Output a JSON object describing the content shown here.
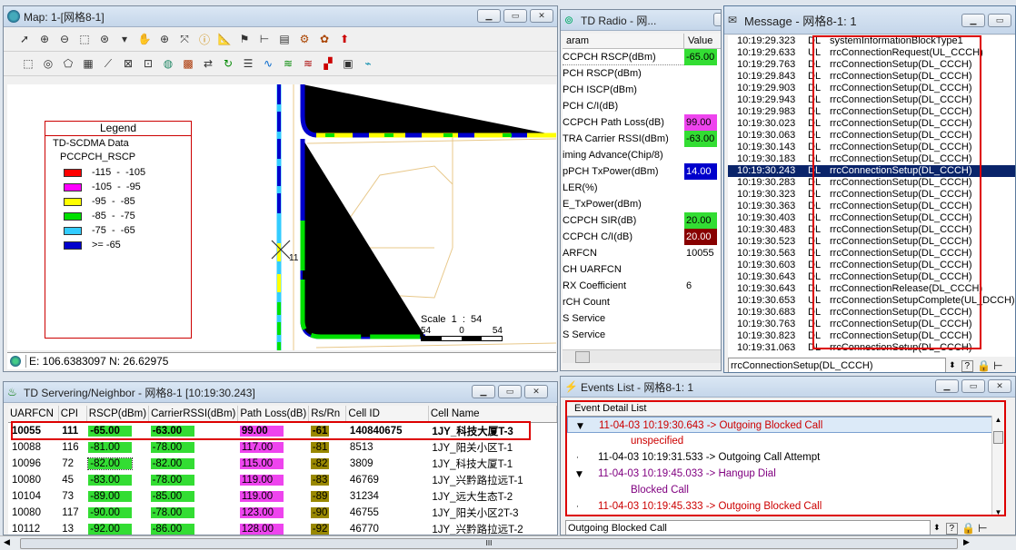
{
  "map": {
    "title": "Map: 1-[网格8-1]",
    "legend": {
      "header": "Legend",
      "data_title": "TD-SCDMA Data",
      "subtitle": "PCCPCH_RSCP",
      "items": [
        {
          "label": "-115  -  -105",
          "color": "#ff0000"
        },
        {
          "label": "-105  -  -95",
          "color": "#ff00ff"
        },
        {
          "label": "-95  -  -85",
          "color": "#ffff00"
        },
        {
          "label": "-85  -  -75",
          "color": "#00e000"
        },
        {
          "label": "-75  -  -65",
          "color": "#33ccff"
        },
        {
          "label": ">= -65",
          "color": "#0000cc"
        }
      ]
    },
    "scale": {
      "label": "Scale  1  :  54",
      "ticks": [
        "54",
        "0",
        "54"
      ]
    },
    "marker_label": "11",
    "status": "E: 106.6383097 N: 26.62975"
  },
  "td_radio": {
    "title": "TD Radio - 网...",
    "header": {
      "param": "aram",
      "value": "Value"
    },
    "rows": [
      {
        "param": "CCPCH RSCP(dBm)",
        "value": "-65.00",
        "color": "#33dd33"
      },
      {
        "param": "PCH RSCP(dBm)",
        "value": "",
        "color": ""
      },
      {
        "param": "PCH ISCP(dBm)",
        "value": "",
        "color": ""
      },
      {
        "param": "PCH C/I(dB)",
        "value": "",
        "color": ""
      },
      {
        "param": "CCPCH Path Loss(dB)",
        "value": "99.00",
        "color": "#ee44ee"
      },
      {
        "param": "TRA Carrier RSSI(dBm)",
        "value": "-63.00",
        "color": "#33dd33"
      },
      {
        "param": "iming Advance(Chip/8)",
        "value": "",
        "color": ""
      },
      {
        "param": "pPCH TxPower(dBm)",
        "value": "14.00",
        "color": "#0000cc"
      },
      {
        "param": "LER(%)",
        "value": "",
        "color": ""
      },
      {
        "param": "E_TxPower(dBm)",
        "value": "",
        "color": ""
      },
      {
        "param": "CCPCH SIR(dB)",
        "value": "20.00",
        "color": "#33dd33"
      },
      {
        "param": "CCPCH C/I(dB)",
        "value": "20.00",
        "color": "#880000"
      },
      {
        "param": "ARFCN",
        "value": "10055",
        "color": ""
      },
      {
        "param": "CH UARFCN",
        "value": "",
        "color": ""
      },
      {
        "param": "RX Coefficient",
        "value": "6",
        "color": ""
      },
      {
        "param": "rCH Count",
        "value": "",
        "color": ""
      },
      {
        "param": "S Service",
        "value": "",
        "color": ""
      },
      {
        "param": "S Service",
        "value": "",
        "color": ""
      }
    ]
  },
  "message": {
    "title": "Message - 网格8-1: 1",
    "rows": [
      {
        "time": "10:19:29.323",
        "dir": "DL",
        "msg": "systemInformationBlockType1"
      },
      {
        "time": "10:19:29.633",
        "dir": "UL",
        "msg": "rrcConnectionRequest(UL_CCCH)"
      },
      {
        "time": "10:19:29.763",
        "dir": "DL",
        "msg": "rrcConnectionSetup(DL_CCCH)"
      },
      {
        "time": "10:19:29.843",
        "dir": "DL",
        "msg": "rrcConnectionSetup(DL_CCCH)"
      },
      {
        "time": "10:19:29.903",
        "dir": "DL",
        "msg": "rrcConnectionSetup(DL_CCCH)"
      },
      {
        "time": "10:19:29.943",
        "dir": "DL",
        "msg": "rrcConnectionSetup(DL_CCCH)"
      },
      {
        "time": "10:19:29.983",
        "dir": "DL",
        "msg": "rrcConnectionSetup(DL_CCCH)"
      },
      {
        "time": "10:19:30.023",
        "dir": "DL",
        "msg": "rrcConnectionSetup(DL_CCCH)"
      },
      {
        "time": "10:19:30.063",
        "dir": "DL",
        "msg": "rrcConnectionSetup(DL_CCCH)"
      },
      {
        "time": "10:19:30.143",
        "dir": "DL",
        "msg": "rrcConnectionSetup(DL_CCCH)"
      },
      {
        "time": "10:19:30.183",
        "dir": "DL",
        "msg": "rrcConnectionSetup(DL_CCCH)"
      },
      {
        "time": "10:19:30.243",
        "dir": "DL",
        "msg": "rrcConnectionSetup(DL_CCCH)"
      },
      {
        "time": "10:19:30.283",
        "dir": "DL",
        "msg": "rrcConnectionSetup(DL_CCCH)"
      },
      {
        "time": "10:19:30.323",
        "dir": "DL",
        "msg": "rrcConnectionSetup(DL_CCCH)"
      },
      {
        "time": "10:19:30.363",
        "dir": "DL",
        "msg": "rrcConnectionSetup(DL_CCCH)"
      },
      {
        "time": "10:19:30.403",
        "dir": "DL",
        "msg": "rrcConnectionSetup(DL_CCCH)"
      },
      {
        "time": "10:19:30.483",
        "dir": "DL",
        "msg": "rrcConnectionSetup(DL_CCCH)"
      },
      {
        "time": "10:19:30.523",
        "dir": "DL",
        "msg": "rrcConnectionSetup(DL_CCCH)"
      },
      {
        "time": "10:19:30.563",
        "dir": "DL",
        "msg": "rrcConnectionSetup(DL_CCCH)"
      },
      {
        "time": "10:19:30.603",
        "dir": "DL",
        "msg": "rrcConnectionSetup(DL_CCCH)"
      },
      {
        "time": "10:19:30.643",
        "dir": "DL",
        "msg": "rrcConnectionSetup(DL_CCCH)"
      },
      {
        "time": "10:19:30.643",
        "dir": "DL",
        "msg": "rrcConnectionRelease(DL_CCCH)"
      },
      {
        "time": "10:19:30.653",
        "dir": "UL",
        "msg": "rrcConnectionSetupComplete(UL_DCCH)"
      },
      {
        "time": "10:19:30.683",
        "dir": "DL",
        "msg": "rrcConnectionSetup(DL_CCCH)"
      },
      {
        "time": "10:19:30.763",
        "dir": "DL",
        "msg": "rrcConnectionSetup(DL_CCCH)"
      },
      {
        "time": "10:19:30.823",
        "dir": "DL",
        "msg": "rrcConnectionSetup(DL_CCCH)"
      },
      {
        "time": "10:19:31.063",
        "dir": "DL",
        "msg": "rrcConnectionSetup(DL_CCCH)"
      }
    ],
    "selected_index": 11,
    "footer_text": "rrcConnectionSetup(DL_CCCH)"
  },
  "serving": {
    "title": "TD Servering/Neighbor - 网格8-1 [10:19:30.243]",
    "headers": [
      "UARFCN",
      "CPI",
      "RSCP(dBm)",
      "CarrierRSSI(dBm)",
      "Path Loss(dB)",
      "Rs/Rn",
      "Cell ID",
      "Cell Name"
    ],
    "rows": [
      {
        "uarfcn": "10055",
        "cpi": "111",
        "rscp": "-65.00",
        "rscp_color": "#33dd33",
        "rssi": "-63.00",
        "rssi_color": "#33dd33",
        "pl": "99.00",
        "pl_color": "#ee44ee",
        "rsrn": "-61",
        "rsrn_color": "#998800",
        "cellid": "140840675",
        "name": "1JY_科技大厦T-3"
      },
      {
        "uarfcn": "10088",
        "cpi": "116",
        "rscp": "-81.00",
        "rscp_color": "#33dd33",
        "rssi": "-78.00",
        "rssi_color": "#33dd33",
        "pl": "117.00",
        "pl_color": "#ee44ee",
        "rsrn": "-81",
        "rsrn_color": "#998800",
        "cellid": "8513",
        "name": "1JY_阳关小区T-1"
      },
      {
        "uarfcn": "10096",
        "cpi": "72",
        "rscp": "-82.00",
        "rscp_color": "#33dd33",
        "rssi": "-82.00",
        "rssi_color": "#33dd33",
        "pl": "115.00",
        "pl_color": "#ee44ee",
        "rsrn": "-82",
        "rsrn_color": "#998800",
        "cellid": "3809",
        "name": "1JY_科技大厦T-1"
      },
      {
        "uarfcn": "10080",
        "cpi": "45",
        "rscp": "-83.00",
        "rscp_color": "#33dd33",
        "rssi": "-78.00",
        "rssi_color": "#33dd33",
        "pl": "119.00",
        "pl_color": "#ee44ee",
        "rsrn": "-83",
        "rsrn_color": "#998800",
        "cellid": "46769",
        "name": "1JY_兴黔路拉远T-1"
      },
      {
        "uarfcn": "10104",
        "cpi": "73",
        "rscp": "-89.00",
        "rscp_color": "#33dd33",
        "rssi": "-85.00",
        "rssi_color": "#33dd33",
        "pl": "119.00",
        "pl_color": "#ee44ee",
        "rsrn": "-89",
        "rsrn_color": "#998800",
        "cellid": "31234",
        "name": "1JY_远大生态T-2"
      },
      {
        "uarfcn": "10080",
        "cpi": "117",
        "rscp": "-90.00",
        "rscp_color": "#33dd33",
        "rssi": "-78.00",
        "rssi_color": "#33dd33",
        "pl": "123.00",
        "pl_color": "#ee44ee",
        "rsrn": "-90",
        "rsrn_color": "#998800",
        "cellid": "46755",
        "name": "1JY_阳关小区2T-3"
      },
      {
        "uarfcn": "10112",
        "cpi": "13",
        "rscp": "-92.00",
        "rscp_color": "#33dd33",
        "rssi": "-86.00",
        "rssi_color": "#33dd33",
        "pl": "128.00",
        "pl_color": "#ee44ee",
        "rsrn": "-92",
        "rsrn_color": "#998800",
        "cellid": "46770",
        "name": "1JY_兴黔路拉远T-2"
      }
    ]
  },
  "events": {
    "title": "Events List - 网格8-1: 1",
    "header": "Event Detail List",
    "rows": [
      {
        "text": "11-04-03 10:19:30.643 -> Outgoing Blocked Call",
        "level": 0,
        "color": "#cc0000",
        "expand": true
      },
      {
        "text": "unspecified",
        "level": 1,
        "color": "#cc0000",
        "expand": false
      },
      {
        "text": "11-04-03 10:19:31.533 -> Outgoing Call Attempt",
        "level": 0,
        "color": "#000000",
        "expand": false
      },
      {
        "text": "11-04-03 10:19:45.033 -> Hangup Dial",
        "level": 0,
        "color": "#800080",
        "expand": true
      },
      {
        "text": "Blocked Call",
        "level": 1,
        "color": "#800080",
        "expand": false
      },
      {
        "text": "11-04-03 10:19:45.333 -> Outgoing Blocked Call",
        "level": 0,
        "color": "#cc0000",
        "expand": false
      }
    ],
    "footer_text": "Outgoing Blocked Call"
  },
  "scrollbar_mark": "III"
}
